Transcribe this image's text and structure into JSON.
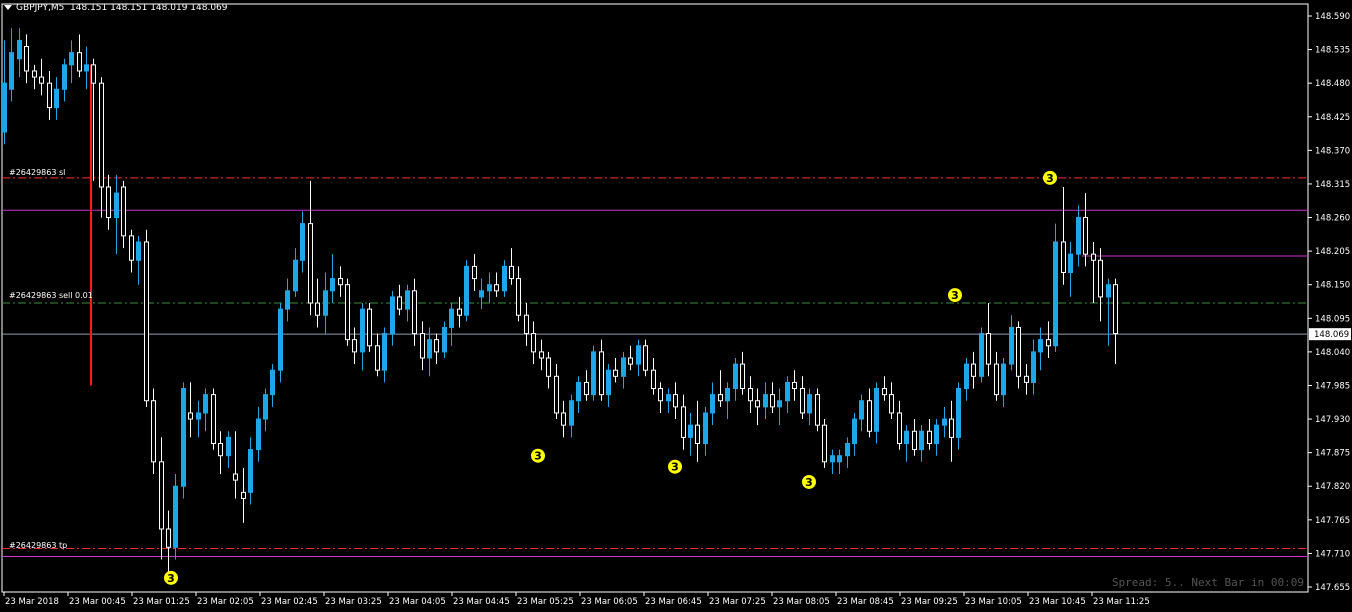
{
  "header": {
    "symbol": "GBPJPY,M5",
    "ohlc": "148.151 148.151 148.019 148.069"
  },
  "orders": {
    "sl_label": "#26429863 sl",
    "entry_label": "#26429863 sell 0.01",
    "tp_label": "#26429863 tp"
  },
  "status": {
    "spread_text": "Spread: 5.. Next Bar in 00:09"
  },
  "colors": {
    "background": "#000000",
    "bull_fill": "#1ea7e8",
    "bear_outline": "#ffffff",
    "sl_line": "#ff2a2a",
    "tp_line": "#ff2a2a",
    "entry_line": "#3a8f3a",
    "magenta_line": "#cc33cc",
    "bid_line": "#8f9bb3",
    "marker_fill": "#ffff00"
  },
  "chart_data": {
    "type": "candlestick",
    "y_ticks": [
      "148.590",
      "148.535",
      "148.480",
      "148.425",
      "148.370",
      "148.315",
      "148.260",
      "148.205",
      "148.150",
      "148.095",
      "148.040",
      "147.985",
      "147.930",
      "147.875",
      "147.820",
      "147.765",
      "147.710",
      "147.655"
    ],
    "ylim": [
      147.655,
      148.59
    ],
    "x_ticks": [
      "23 Mar 2018",
      "23 Mar 00:45",
      "23 Mar 01:25",
      "23 Mar 02:05",
      "23 Mar 02:45",
      "23 Mar 03:25",
      "23 Mar 04:05",
      "23 Mar 04:45",
      "23 Mar 05:25",
      "23 Mar 06:05",
      "23 Mar 06:45",
      "23 Mar 07:25",
      "23 Mar 08:05",
      "23 Mar 08:45",
      "23 Mar 09:25",
      "23 Mar 10:05",
      "23 Mar 10:45",
      "23 Mar 11:25"
    ],
    "current_price": "148.069",
    "levels": {
      "sl": 148.325,
      "entry": 148.12,
      "tp": 147.718,
      "magenta_upper": 148.272,
      "magenta_lower": 147.705,
      "magenta_right": 148.197,
      "bid": 148.069
    },
    "red_vertical": {
      "from": 148.51,
      "to": 147.985
    },
    "markers": [
      {
        "label": "3",
        "price": 147.67
      },
      {
        "label": "3",
        "price": 147.87
      },
      {
        "label": "3",
        "price": 147.852
      },
      {
        "label": "3",
        "price": 147.827
      },
      {
        "label": "3",
        "price": 148.133
      },
      {
        "label": "3",
        "price": 148.325
      }
    ],
    "candles": [
      [
        148.4,
        148.55,
        148.38,
        148.48
      ],
      [
        148.47,
        148.57,
        148.45,
        148.53
      ],
      [
        148.52,
        148.57,
        148.49,
        148.55
      ],
      [
        148.54,
        148.56,
        148.48,
        148.5
      ],
      [
        148.5,
        148.51,
        148.47,
        148.49
      ],
      [
        148.49,
        148.52,
        148.46,
        148.48
      ],
      [
        148.48,
        148.5,
        148.42,
        148.44
      ],
      [
        148.44,
        148.49,
        148.42,
        148.47
      ],
      [
        148.47,
        148.52,
        148.45,
        148.51
      ],
      [
        148.51,
        148.55,
        148.48,
        148.53
      ],
      [
        148.53,
        148.56,
        148.49,
        148.5
      ],
      [
        148.5,
        148.54,
        148.47,
        148.51
      ],
      [
        148.51,
        148.52,
        148.32,
        148.48
      ],
      [
        148.48,
        148.49,
        148.26,
        148.31
      ],
      [
        148.31,
        148.33,
        148.24,
        148.26
      ],
      [
        148.26,
        148.33,
        148.2,
        148.3
      ],
      [
        148.31,
        148.32,
        148.21,
        148.23
      ],
      [
        148.23,
        148.24,
        148.17,
        148.19
      ],
      [
        148.19,
        148.23,
        148.15,
        148.22
      ],
      [
        148.22,
        148.24,
        147.95,
        147.96
      ],
      [
        147.96,
        147.98,
        147.84,
        147.86
      ],
      [
        147.86,
        147.9,
        147.7,
        147.75
      ],
      [
        147.75,
        147.78,
        147.68,
        147.72
      ],
      [
        147.72,
        147.84,
        147.7,
        147.82
      ],
      [
        147.82,
        147.99,
        147.8,
        147.98
      ],
      [
        147.94,
        147.99,
        147.9,
        147.93
      ],
      [
        147.93,
        147.96,
        147.9,
        147.94
      ],
      [
        147.94,
        147.98,
        147.91,
        147.97
      ],
      [
        147.97,
        147.98,
        147.88,
        147.89
      ],
      [
        147.89,
        147.91,
        147.84,
        147.87
      ],
      [
        147.87,
        147.91,
        147.85,
        147.9
      ],
      [
        147.84,
        147.91,
        147.8,
        147.83
      ],
      [
        147.81,
        147.85,
        147.76,
        147.8
      ],
      [
        147.81,
        147.9,
        147.79,
        147.88
      ],
      [
        147.88,
        147.95,
        147.86,
        147.93
      ],
      [
        147.93,
        147.98,
        147.91,
        147.97
      ],
      [
        147.97,
        148.02,
        147.95,
        148.01
      ],
      [
        148.01,
        148.12,
        147.99,
        148.11
      ],
      [
        148.11,
        148.16,
        148.09,
        148.14
      ],
      [
        148.14,
        148.21,
        148.13,
        148.19
      ],
      [
        148.19,
        148.27,
        148.17,
        148.25
      ],
      [
        148.25,
        148.32,
        148.1,
        148.12
      ],
      [
        148.12,
        148.16,
        148.08,
        148.1
      ],
      [
        148.1,
        148.17,
        148.07,
        148.14
      ],
      [
        148.14,
        148.2,
        148.12,
        148.16
      ],
      [
        148.16,
        148.18,
        148.13,
        148.15
      ],
      [
        148.15,
        148.16,
        148.05,
        148.06
      ],
      [
        148.06,
        148.08,
        148.02,
        148.04
      ],
      [
        148.04,
        148.12,
        148.01,
        148.11
      ],
      [
        148.11,
        148.12,
        148.04,
        148.05
      ],
      [
        148.05,
        148.07,
        148.0,
        148.01
      ],
      [
        148.01,
        148.08,
        147.99,
        148.07
      ],
      [
        148.07,
        148.14,
        148.05,
        148.13
      ],
      [
        148.13,
        148.15,
        148.1,
        148.11
      ],
      [
        148.11,
        148.15,
        148.09,
        148.14
      ],
      [
        148.14,
        148.16,
        148.05,
        148.07
      ],
      [
        148.07,
        148.09,
        148.01,
        148.03
      ],
      [
        148.03,
        148.08,
        148.0,
        148.06
      ],
      [
        148.06,
        148.07,
        148.02,
        148.04
      ],
      [
        148.04,
        148.09,
        148.03,
        148.08
      ],
      [
        148.08,
        148.12,
        148.05,
        148.11
      ],
      [
        148.11,
        148.13,
        148.08,
        148.1
      ],
      [
        148.1,
        148.19,
        148.09,
        148.18
      ],
      [
        148.18,
        148.2,
        148.14,
        148.16
      ],
      [
        148.13,
        148.16,
        148.11,
        148.14
      ],
      [
        148.14,
        148.17,
        148.12,
        148.15
      ],
      [
        148.15,
        148.17,
        148.13,
        148.14
      ],
      [
        148.14,
        148.19,
        148.13,
        148.18
      ],
      [
        148.18,
        148.21,
        148.15,
        148.16
      ],
      [
        148.16,
        148.18,
        148.09,
        148.1
      ],
      [
        148.1,
        148.12,
        148.05,
        148.07
      ],
      [
        148.07,
        148.09,
        148.02,
        148.04
      ],
      [
        148.04,
        148.06,
        148.01,
        148.03
      ],
      [
        148.03,
        148.04,
        147.98,
        148.0
      ],
      [
        148.0,
        148.02,
        147.93,
        147.94
      ],
      [
        147.94,
        147.96,
        147.9,
        147.92
      ],
      [
        147.92,
        147.97,
        147.9,
        147.96
      ],
      [
        147.96,
        148.0,
        147.94,
        147.99
      ],
      [
        147.99,
        148.01,
        147.96,
        147.97
      ],
      [
        147.97,
        148.05,
        147.96,
        148.04
      ],
      [
        148.04,
        148.06,
        147.96,
        147.97
      ],
      [
        147.97,
        148.02,
        147.95,
        148.01
      ],
      [
        148.01,
        148.03,
        147.99,
        148.0
      ],
      [
        148.0,
        148.04,
        147.98,
        148.03
      ],
      [
        148.03,
        148.05,
        148.01,
        148.02
      ],
      [
        148.02,
        148.06,
        148.0,
        148.05
      ],
      [
        148.05,
        148.06,
        148.0,
        148.01
      ],
      [
        148.01,
        148.03,
        147.97,
        147.98
      ],
      [
        147.98,
        147.99,
        147.94,
        147.96
      ],
      [
        147.96,
        147.98,
        147.94,
        147.97
      ],
      [
        147.97,
        147.99,
        147.93,
        147.95
      ],
      [
        147.95,
        147.97,
        147.88,
        147.9
      ],
      [
        147.9,
        147.94,
        147.87,
        147.92
      ],
      [
        147.92,
        147.96,
        147.86,
        147.89
      ],
      [
        147.89,
        147.95,
        147.87,
        147.94
      ],
      [
        147.94,
        147.99,
        147.92,
        147.97
      ],
      [
        147.97,
        148.01,
        147.95,
        147.96
      ],
      [
        147.96,
        147.99,
        147.93,
        147.98
      ],
      [
        147.98,
        148.03,
        147.96,
        148.02
      ],
      [
        148.02,
        148.04,
        147.97,
        147.98
      ],
      [
        147.98,
        148.0,
        147.94,
        147.96
      ],
      [
        147.96,
        147.98,
        147.92,
        147.95
      ],
      [
        147.95,
        147.99,
        147.93,
        147.97
      ],
      [
        147.97,
        147.99,
        147.94,
        147.95
      ],
      [
        147.95,
        147.98,
        147.92,
        147.96
      ],
      [
        147.96,
        148.0,
        147.94,
        147.99
      ],
      [
        147.99,
        148.01,
        147.96,
        147.98
      ],
      [
        147.98,
        148.0,
        147.93,
        147.94
      ],
      [
        147.94,
        147.98,
        147.92,
        147.97
      ],
      [
        147.97,
        147.98,
        147.91,
        147.92
      ],
      [
        147.92,
        147.93,
        147.85,
        147.86
      ],
      [
        147.86,
        147.88,
        147.84,
        147.87
      ],
      [
        147.86,
        147.88,
        147.84,
        147.87
      ],
      [
        147.87,
        147.9,
        147.85,
        147.89
      ],
      [
        147.89,
        147.94,
        147.87,
        147.93
      ],
      [
        147.93,
        147.97,
        147.91,
        147.96
      ],
      [
        147.96,
        147.98,
        147.9,
        147.91
      ],
      [
        147.91,
        147.99,
        147.89,
        147.98
      ],
      [
        147.98,
        148.0,
        147.96,
        147.97
      ],
      [
        147.97,
        147.99,
        147.93,
        147.94
      ],
      [
        147.94,
        147.96,
        147.88,
        147.89
      ],
      [
        147.89,
        147.92,
        147.86,
        147.91
      ],
      [
        147.91,
        147.93,
        147.87,
        147.88
      ],
      [
        147.88,
        147.92,
        147.86,
        147.91
      ],
      [
        147.91,
        147.93,
        147.88,
        147.89
      ],
      [
        147.89,
        147.93,
        147.87,
        147.92
      ],
      [
        147.92,
        147.95,
        147.9,
        147.93
      ],
      [
        147.93,
        147.96,
        147.86,
        147.9
      ],
      [
        147.9,
        147.99,
        147.88,
        147.98
      ],
      [
        147.98,
        148.03,
        147.96,
        148.02
      ],
      [
        148.02,
        148.04,
        147.98,
        148.0
      ],
      [
        148.0,
        148.08,
        147.99,
        148.07
      ],
      [
        148.07,
        148.12,
        148.0,
        148.02
      ],
      [
        148.02,
        148.04,
        147.96,
        147.97
      ],
      [
        147.97,
        148.03,
        147.95,
        148.02
      ],
      [
        148.02,
        148.1,
        148.01,
        148.08
      ],
      [
        148.08,
        148.09,
        147.98,
        148.0
      ],
      [
        148.0,
        148.02,
        147.97,
        147.99
      ],
      [
        147.99,
        148.06,
        147.97,
        148.04
      ],
      [
        148.04,
        148.08,
        148.01,
        148.06
      ],
      [
        148.06,
        148.09,
        148.03,
        148.05
      ],
      [
        148.05,
        148.25,
        148.04,
        148.22
      ],
      [
        148.22,
        148.31,
        148.15,
        148.17
      ],
      [
        148.17,
        148.22,
        148.13,
        148.2
      ],
      [
        148.2,
        148.28,
        148.18,
        148.26
      ],
      [
        148.26,
        148.3,
        148.18,
        148.2
      ],
      [
        148.2,
        148.22,
        148.12,
        148.19
      ],
      [
        148.19,
        148.21,
        148.09,
        148.13
      ],
      [
        148.13,
        148.16,
        148.05,
        148.15
      ],
      [
        148.15,
        148.16,
        148.02,
        148.07
      ]
    ]
  }
}
